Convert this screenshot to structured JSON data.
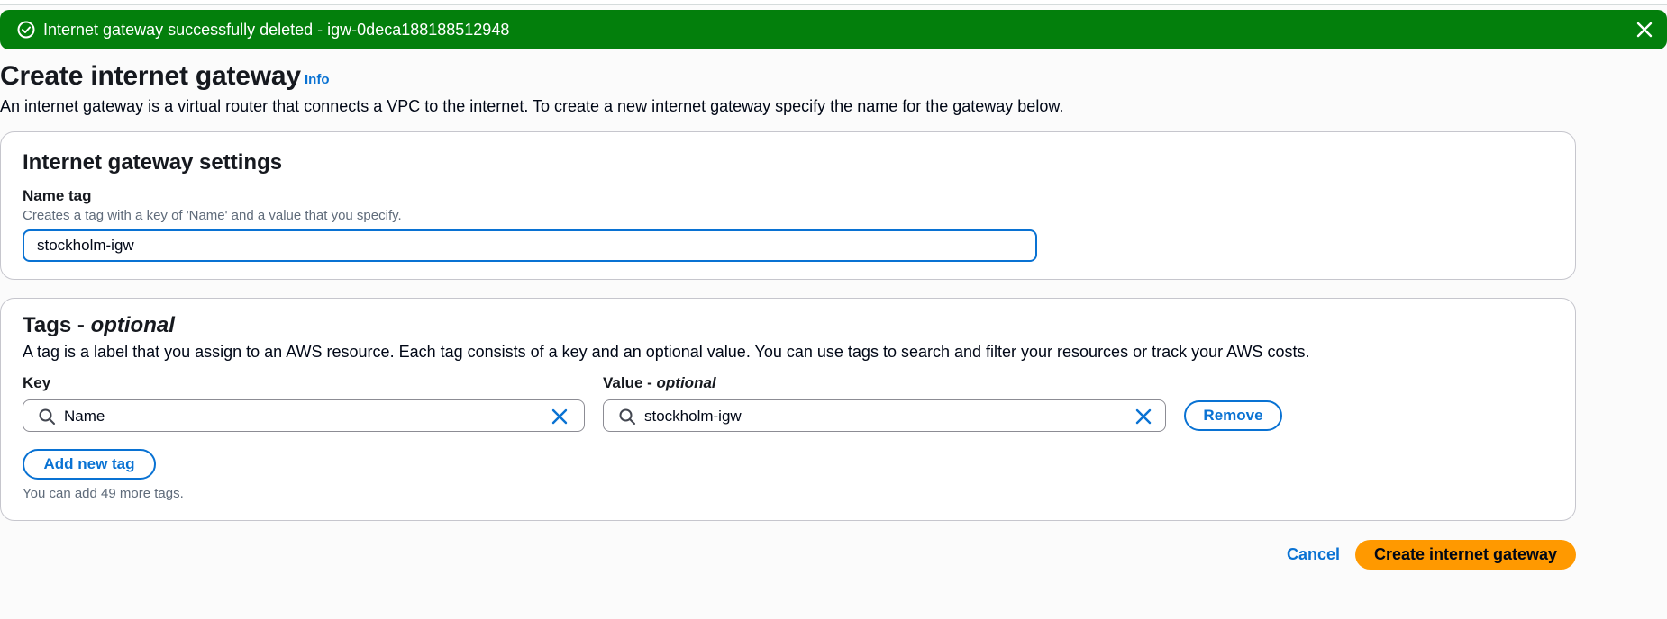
{
  "flash": {
    "message": "Internet gateway successfully deleted - igw-0deca188188512948",
    "status_icon": "success-check-circle-icon",
    "close_icon": "close-icon",
    "color": "#037f0c"
  },
  "header": {
    "title": "Create internet gateway",
    "info_link": "Info",
    "description": "An internet gateway is a virtual router that connects a VPC to the internet. To create a new internet gateway specify the name for the gateway below."
  },
  "settings": {
    "heading": "Internet gateway settings",
    "name_tag_label": "Name tag",
    "name_tag_hint": "Creates a tag with a key of 'Name' and a value that you specify.",
    "name_tag_value": "stockholm-igw"
  },
  "tags": {
    "heading_main": "Tags - ",
    "heading_optional": "optional",
    "description": "A tag is a label that you assign to an AWS resource. Each tag consists of a key and an optional value. You can use tags to search and filter your resources or track your AWS costs.",
    "key_label": "Key",
    "value_label_main": "Value - ",
    "value_label_optional": "optional",
    "rows": [
      {
        "key": "Name",
        "value": "stockholm-igw"
      }
    ],
    "remove_label": "Remove",
    "add_label": "Add new tag",
    "remaining_hint": "You can add 49 more tags."
  },
  "footer": {
    "cancel_label": "Cancel",
    "submit_label": "Create internet gateway"
  },
  "colors": {
    "accent": "#0972d3",
    "primary_button": "#ff9900",
    "success": "#037f0c"
  }
}
